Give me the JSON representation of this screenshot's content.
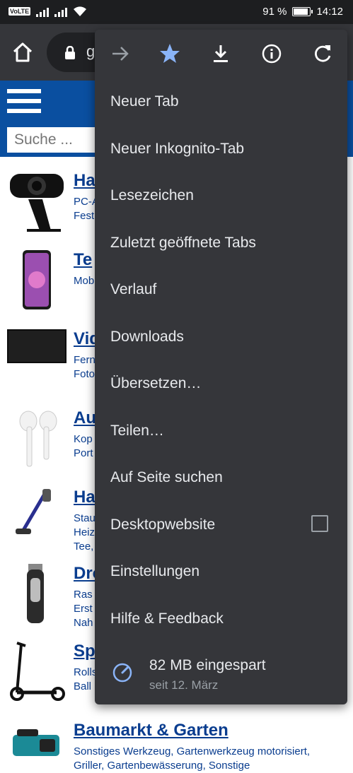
{
  "status_bar": {
    "volte": "VoLTE",
    "battery_percent_text": "91 %",
    "battery_level": 0.91,
    "time": "14:12"
  },
  "toolbar": {
    "home_icon": "home-icon",
    "url_partial": "g",
    "lock_icon": "lock-icon"
  },
  "site": {
    "search_placeholder": "Suche ...",
    "categories": [
      {
        "title": "Ha",
        "sub1": "PC-A",
        "sub2": "Fest"
      },
      {
        "title": "Te",
        "sub1": "Mob",
        "sub2": ""
      },
      {
        "title": "Vid",
        "sub1": "Fern",
        "sub2": "Foto"
      },
      {
        "title": "Au",
        "sub1": "Kop",
        "sub2": "Port"
      },
      {
        "title": "Ha",
        "sub1": "Stau",
        "sub2": "Heiz",
        "sub3": "Tee,"
      },
      {
        "title": "Dro",
        "sub1": "Ras",
        "sub2": "Erst",
        "sub3": "Nah"
      },
      {
        "title": "Sp",
        "sub1": "Rolls",
        "sub2": "Ball"
      },
      {
        "title": "Baumarkt & Garten",
        "sub1": "Sonstiges Werkzeug, Gartenwerkzeug motorisiert,",
        "sub2": "Griller, Gartenbewässerung, Sonstige"
      }
    ]
  },
  "menu": {
    "icons": [
      "forward-icon",
      "bookmark-star-icon",
      "download-icon",
      "info-icon",
      "reload-icon"
    ],
    "items": [
      "Neuer Tab",
      "Neuer Inkognito-Tab",
      "Lesezeichen",
      "Zuletzt geöffnete Tabs",
      "Verlauf",
      "Downloads",
      "Übersetzen…",
      "Teilen…",
      "Auf Seite suchen",
      "Desktopwebsite",
      "Einstellungen",
      "Hilfe & Feedback"
    ],
    "desktop_checked": false,
    "savings_title": "82 MB eingespart",
    "savings_sub": "seit 12. März"
  },
  "colors": {
    "menu_bg": "#35363a",
    "accent_blue": "#8ab4f8",
    "site_blue": "#0a4fa0",
    "link_blue": "#0a3d8f"
  }
}
